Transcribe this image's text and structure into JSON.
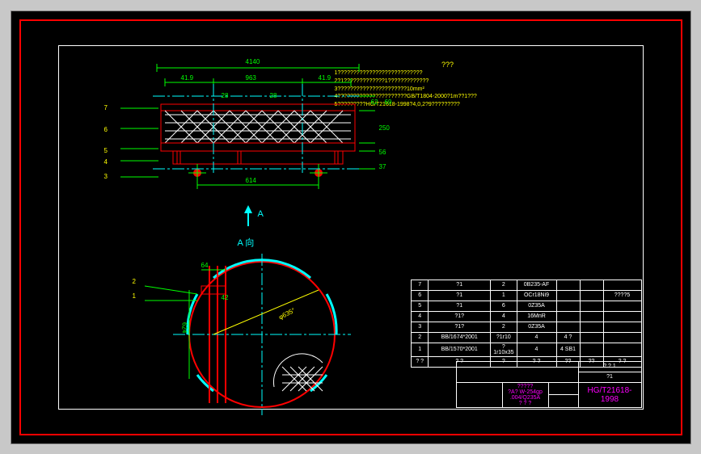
{
  "annotations": {
    "title": "???",
    "l1": "1???????????????????????????",
    "l2": "2?1?????????????1?????????????",
    "l3": "3??????????????????????10mm²",
    "l4": "4??????????????????????GB/T1804-2000?1m??1???",
    "l5": "5?????????HG/T21618-1998?4,0,2?9?????????"
  },
  "dims": {
    "d1": "4140",
    "d2": "41.9",
    "d3": "963",
    "d4": "41.9",
    "d5": "28",
    "d6": "28",
    "d7": "614",
    "h1": "62",
    "h2": "69",
    "h3": "250",
    "h4": "56",
    "h5": "37",
    "cd1": "64",
    "cd2": "42",
    "cd3": "624",
    "cang": "φ635°"
  },
  "callouts": {
    "c1": "1",
    "c2": "2",
    "c3": "3",
    "c4": "4",
    "c5": "5",
    "c6": "6",
    "c7": "7"
  },
  "views": {
    "arrow": "A",
    "section": "A 向"
  },
  "parts": {
    "r7": {
      "no": "7",
      "name": "?1",
      "qty": "2",
      "mat": "0B235-AF",
      "wt": "",
      "note": ""
    },
    "r6": {
      "no": "6",
      "name": "?1",
      "qty": "1",
      "mat": "OCr18Ni9",
      "wt": "",
      "note": "????5"
    },
    "r5": {
      "no": "5",
      "name": "?1",
      "qty": "6",
      "mat": "0Z35A",
      "wt": "",
      "note": ""
    },
    "r4": {
      "no": "4",
      "name": "?1?",
      "qty": "4",
      "mat": "16MnR",
      "wt": "",
      "note": ""
    },
    "r3": {
      "no": "3",
      "name": "?1?",
      "qty": "2",
      "mat": "0Z35A",
      "wt": "",
      "note": ""
    },
    "r2": {
      "no": "2",
      "name": "BB/1674*2001",
      "qty": "?1r10",
      "mat": "4",
      "wt": "4 ?",
      "note": ""
    },
    "r1": {
      "no": "1",
      "name": "BB/1570*2001",
      "qty": "?1r10x35",
      "mat": "4",
      "wt": "4 SB1",
      "note": ""
    },
    "h": {
      "c1": "? ?",
      "c2": "?  ?",
      "c3": "?",
      "c4": "? ?",
      "c5": "??",
      "c6": "??",
      "c7": "?  ?"
    }
  },
  "title_block": {
    "proj": "?????",
    "desc": "?A? W-254gp .004/Q235A",
    "sub": "? ? ?",
    "std": "HG/T21618-1998",
    "t1": "? ? 1",
    "t2": "?1"
  }
}
